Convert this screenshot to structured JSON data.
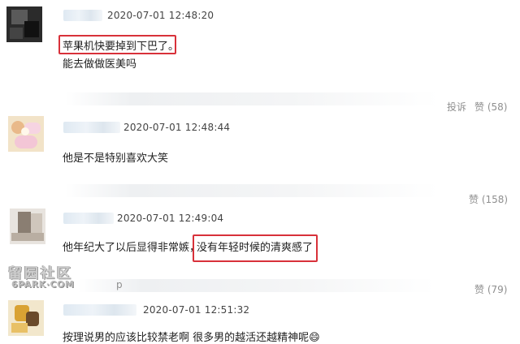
{
  "comments": [
    {
      "timestamp": "2020-07-01 12:48:20",
      "lines": [
        "苹果机快要掉到下巴了。",
        "能去做做医美吗"
      ],
      "like_count": "(58)"
    },
    {
      "timestamp": "2020-07-01 12:48:44",
      "lines": [
        "他是不是特别喜欢大笑"
      ],
      "like_count": "(158)"
    },
    {
      "timestamp": "2020-07-01 12:49:04",
      "line_prefix": "他年纪大了以后显得非常嫉，",
      "line_highlight": "没有年轻时候的清爽感了",
      "like_count": "(79)"
    },
    {
      "timestamp": "2020-07-01 12:51:32",
      "lines": [
        "按理说男的应该比较禁老啊 很多男的越活还越精神呢😄"
      ]
    }
  ],
  "actions": {
    "report": "投诉",
    "like": "赞"
  },
  "partial_username": "p",
  "watermark": {
    "line1": "留园社区",
    "line2": "6PARK·COM"
  },
  "icons": {
    "emoji": "grinning-face-emoji",
    "report": "report-link",
    "like": "like-link"
  }
}
